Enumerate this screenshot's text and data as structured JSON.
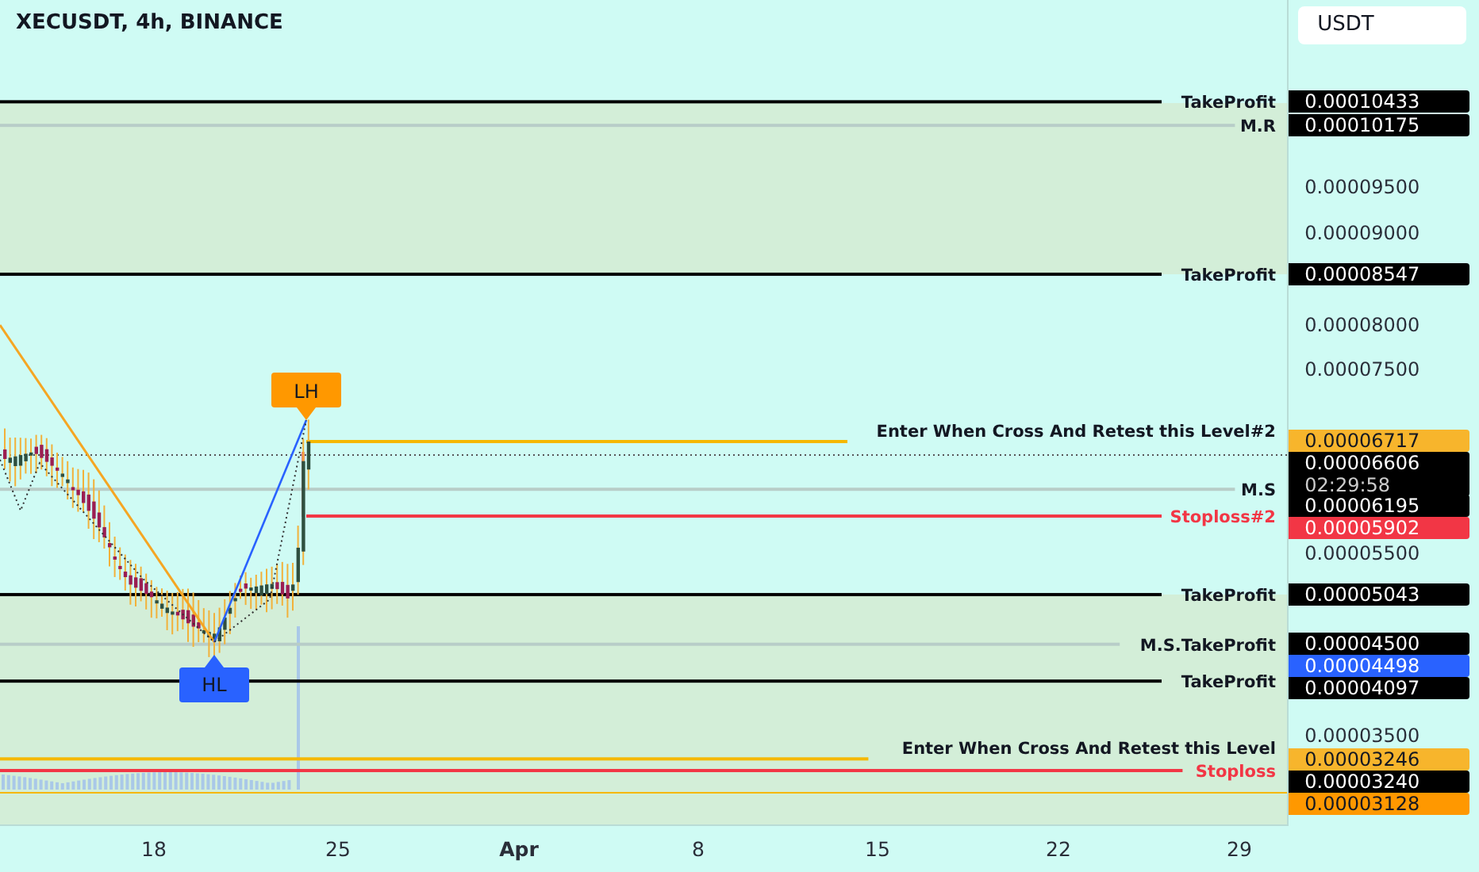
{
  "title": "XECUSDT, 4h, BINANCE",
  "currency": "USDT",
  "price_scale": [
    "0.00009500",
    "0.00009000",
    "0.00008000",
    "0.00007500",
    "0.00005500",
    "0.00003500"
  ],
  "levels": [
    {
      "label": "TakeProfit",
      "price": "0.00010433",
      "kind": "takeprofit",
      "color": "#000000",
      "starts_at_pivot": false
    },
    {
      "label": "M.R",
      "price": "0.00010175",
      "kind": "ms",
      "color": "#000000",
      "starts_at_pivot": false
    },
    {
      "label": "TakeProfit",
      "price": "0.00008547",
      "kind": "takeprofit",
      "color": "#000000",
      "starts_at_pivot": false
    },
    {
      "label": "Enter When Cross And Retest this Level#2",
      "price": "0.00006717",
      "kind": "enter",
      "color": "#f7b52c",
      "starts_at_pivot": true
    },
    {
      "label": "M.S",
      "price": "0.00006195",
      "kind": "ms",
      "color": "#000000",
      "starts_at_pivot": false
    },
    {
      "label": "Stoploss#2",
      "price": "0.00005902",
      "kind": "stoploss",
      "color": "#f23645",
      "starts_at_pivot": true
    },
    {
      "label": "TakeProfit",
      "price": "0.00005043",
      "kind": "takeprofit",
      "color": "#000000",
      "starts_at_pivot": false
    },
    {
      "label": "M.S.TakeProfit",
      "price": "0.00004500",
      "kind": "ms",
      "color": "#000000",
      "starts_at_pivot": false
    },
    {
      "label": "TakeProfit",
      "price": "0.00004097",
      "kind": "takeprofit",
      "color": "#000000",
      "starts_at_pivot": false
    },
    {
      "label": "Enter When Cross And Retest this Level",
      "price": "0.00003246",
      "kind": "enter",
      "color": "#f7b52c",
      "starts_at_pivot": false
    },
    {
      "label": "Stoploss",
      "price": "0.00003240",
      "kind": "stoploss",
      "color": "#000000",
      "starts_at_pivot": false
    }
  ],
  "axis_markers": [
    {
      "price": "0.00006606",
      "countdown": "02:29:58",
      "color": "#000000"
    },
    {
      "price": "0.00004498",
      "color": "#2962ff"
    },
    {
      "price": "0.00003128",
      "color": "#ff9800"
    }
  ],
  "pivots": [
    {
      "label": "LH",
      "kind": "high",
      "color": "#ff9800"
    },
    {
      "label": "HL",
      "kind": "low",
      "color": "#2962ff"
    }
  ],
  "time_axis": [
    {
      "label": "18",
      "bold": false
    },
    {
      "label": "25",
      "bold": false
    },
    {
      "label": "Apr",
      "bold": true
    },
    {
      "label": "8",
      "bold": false
    },
    {
      "label": "15",
      "bold": false
    },
    {
      "label": "22",
      "bold": false
    },
    {
      "label": "29",
      "bold": false
    }
  ]
}
